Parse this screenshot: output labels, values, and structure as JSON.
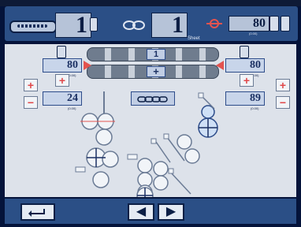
{
  "header": {
    "count_a": "1",
    "count_b": "1",
    "sheet_label": "Sheet",
    "feed_value": "80",
    "feed_unit": "(0.00)"
  },
  "main": {
    "top_indicator": "1",
    "left_value": "80",
    "left_unit": "(0.00)",
    "right_value": "80",
    "right_unit": "(0.00)",
    "left_lower_value": "24",
    "left_lower_unit": "(0.00)",
    "right_lower_value": "89",
    "right_lower_unit": "(0.00)"
  },
  "icons": {
    "plus": "+",
    "minus": "−",
    "left": "◀",
    "right": "▶"
  },
  "colors": {
    "accent": "#e3534f",
    "panel": "#dde2ea",
    "bar": "#2b4f86"
  }
}
